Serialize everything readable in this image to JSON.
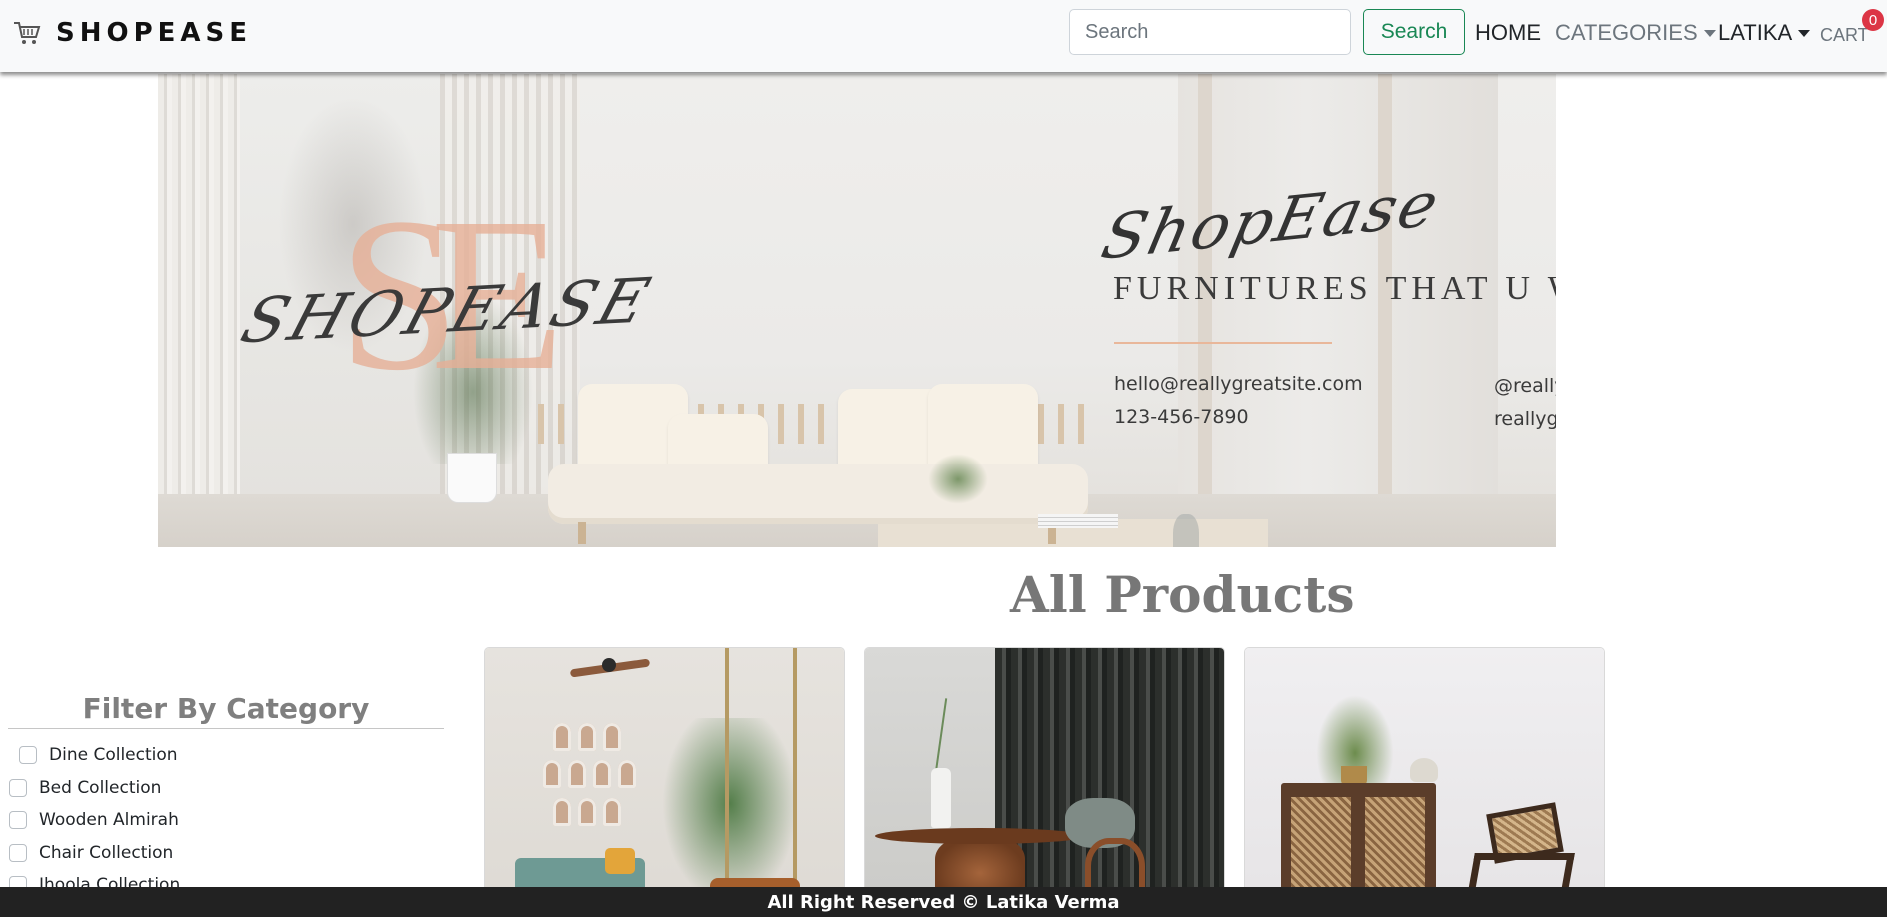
{
  "navbar": {
    "brand_name": "SHOPEASE",
    "brand_icon": "shopping-cart-icon",
    "search": {
      "placeholder": "Search",
      "value": "",
      "button_label": "Search"
    },
    "links": {
      "home": "HOME",
      "categories": "CATEGORIES",
      "user": "LATIKA",
      "cart": "CART"
    },
    "cart_count": "0"
  },
  "banner": {
    "monogram": "SE",
    "script_brand": "SHOPEASE",
    "script_title": "ShopEase",
    "tagline": "FURNITURES THAT U WANT",
    "email": "hello@reallygreatsite.com",
    "phone": "123-456-7890",
    "handle": "@reallygreatsite",
    "website": "reallygreatsite.com"
  },
  "main": {
    "title": "All Products"
  },
  "filter": {
    "title": "Filter By Category",
    "categories": [
      {
        "label": "Dine Collection",
        "checked": false
      },
      {
        "label": "Bed Collection",
        "checked": false
      },
      {
        "label": "Wooden Almirah",
        "checked": false
      },
      {
        "label": "Chair Collection",
        "checked": false
      },
      {
        "label": "Jhoola Collection",
        "checked": false
      }
    ]
  },
  "products": [
    {
      "image": "living-room-swing-image"
    },
    {
      "image": "dining-table-image"
    },
    {
      "image": "cabinet-chair-image"
    }
  ],
  "footer": {
    "text": "All Right Reserved © Latika Verma"
  },
  "colors": {
    "navbar_bg": "#f8f9fa",
    "search_button": "#198754",
    "badge": "#dc3545",
    "footer_bg": "#222222",
    "monogram": "#e6af96"
  }
}
